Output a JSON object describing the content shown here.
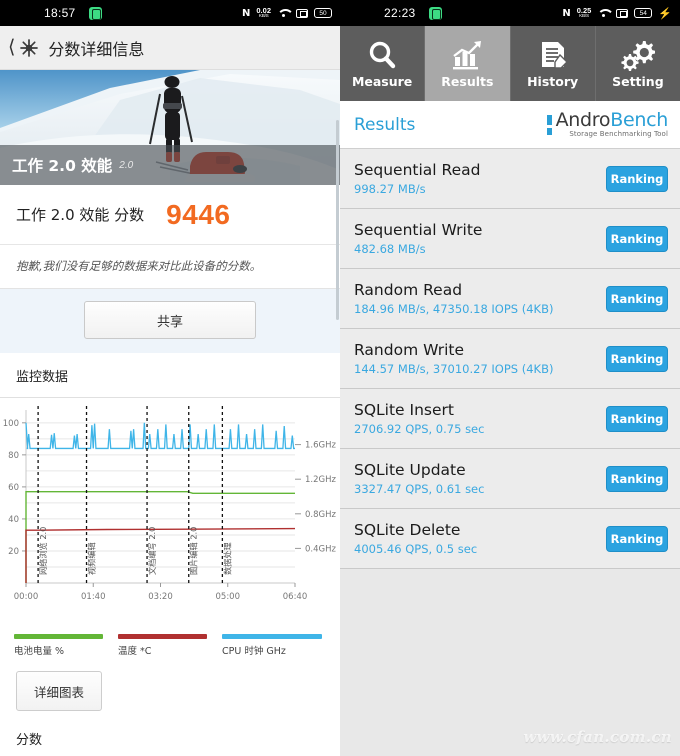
{
  "left": {
    "status": {
      "time": "18:57",
      "net_speed": "0.02",
      "net_unit": "KB/S",
      "battery": "50",
      "nfc": "N"
    },
    "appbar": {
      "title": "分数详细信息",
      "back_icon": "back-chevron-icon",
      "logo_icon": "pcmark-logo-icon"
    },
    "hero": {
      "caption": "工作 2.0 效能",
      "version": "2.0",
      "image_alt": "skier-pulling-sled-photo"
    },
    "score": {
      "label": "工作 2.0 效能 分数",
      "value": "9446"
    },
    "note": "抱歉,我们没有足够的数据来对比此设备的分数。",
    "share_label": "共享",
    "section_monitor": "监控数据",
    "detail_chart_label": "详细图表",
    "section_scores": "分数",
    "chart_data": {
      "type": "line",
      "title": "监控数据",
      "xlabel": "",
      "ylabel": "",
      "x_ticks": [
        "00:00",
        "01:40",
        "03:20",
        "05:00",
        "06:40"
      ],
      "y_left_ticks": [
        100,
        80,
        60,
        40,
        20
      ],
      "y_left_range": [
        0,
        108
      ],
      "y_right_ticks": [
        "1.6GHz",
        "1.2GHz",
        "0.8GHz",
        "0.4GHz"
      ],
      "y_right_range": [
        0,
        2.0
      ],
      "grid": true,
      "legend_position": "bottom",
      "series": [
        {
          "name": "电池电量 %",
          "color": "#63b637",
          "axis": "left",
          "points": [
            [
              0,
              57
            ],
            [
              4.6,
              57
            ],
            [
              4.65,
              57
            ],
            [
              60,
              57
            ],
            [
              62,
              56
            ],
            [
              100,
              56
            ]
          ]
        },
        {
          "name": "温度 *C",
          "color": "#b03030",
          "axis": "left",
          "points": [
            [
              0,
              33
            ],
            [
              4.6,
              33
            ],
            [
              30,
              33.4
            ],
            [
              60,
              33.6
            ],
            [
              100,
              34
            ]
          ]
        },
        {
          "name": "CPU 时钟 GHz",
          "color": "#3fb5e8",
          "axis": "right",
          "baseline": 84,
          "spikes": [
            1,
            9.5,
            10.5,
            18,
            19,
            24.5,
            25.5,
            31,
            39,
            40,
            44,
            46,
            49,
            52,
            55,
            58,
            61,
            64,
            67,
            70,
            76,
            79,
            82,
            85,
            88,
            93,
            96,
            99
          ]
        }
      ],
      "markers": [
        {
          "x": 4.5,
          "label": "网络浏览 2.0"
        },
        {
          "x": 22.5,
          "label": "视频编辑"
        },
        {
          "x": 45.0,
          "label": "文档编写 2.0"
        },
        {
          "x": 60.5,
          "label": "图片编辑 2.0"
        },
        {
          "x": 73.0,
          "label": "数据处理"
        }
      ],
      "legend": [
        "电池电量 %",
        "温度 *C",
        "CPU 时钟 GHz"
      ]
    }
  },
  "right": {
    "status": {
      "time": "22:23",
      "net_speed": "0.25",
      "net_unit": "KB/S",
      "battery": "54",
      "nfc": "N",
      "charging": "⚡"
    },
    "tabs": [
      {
        "label": "Measure",
        "icon": "magnifier-icon",
        "active": false
      },
      {
        "label": "Results",
        "icon": "bar-chart-icon",
        "active": true
      },
      {
        "label": "History",
        "icon": "document-pen-icon",
        "active": false
      },
      {
        "label": "Setting",
        "icon": "gears-icon",
        "active": false
      }
    ],
    "header": {
      "title": "Results",
      "brand_line1a": "Andro",
      "brand_line1b": "Bench",
      "brand_line2": "Storage Benchmarking Tool"
    },
    "rank_label": "Ranking",
    "results": [
      {
        "name": "Sequential Read",
        "value": "998.27 MB/s"
      },
      {
        "name": "Sequential Write",
        "value": "482.68 MB/s"
      },
      {
        "name": "Random Read",
        "value": "184.96 MB/s, 47350.18 IOPS (4KB)"
      },
      {
        "name": "Random Write",
        "value": "144.57 MB/s, 37010.27 IOPS (4KB)"
      },
      {
        "name": "SQLite Insert",
        "value": "2706.92 QPS, 0.75 sec"
      },
      {
        "name": "SQLite Update",
        "value": "3327.47 QPS, 0.61 sec"
      },
      {
        "name": "SQLite Delete",
        "value": "4005.46 QPS, 0.5 sec"
      }
    ],
    "watermark": "www.cfan.com.cn"
  },
  "colors": {
    "accent_orange": "#f26a21",
    "accent_blue": "#2ba3e0",
    "battery_green": "#63b637",
    "temp_red": "#b03030",
    "cpu_blue": "#3fb5e8"
  }
}
